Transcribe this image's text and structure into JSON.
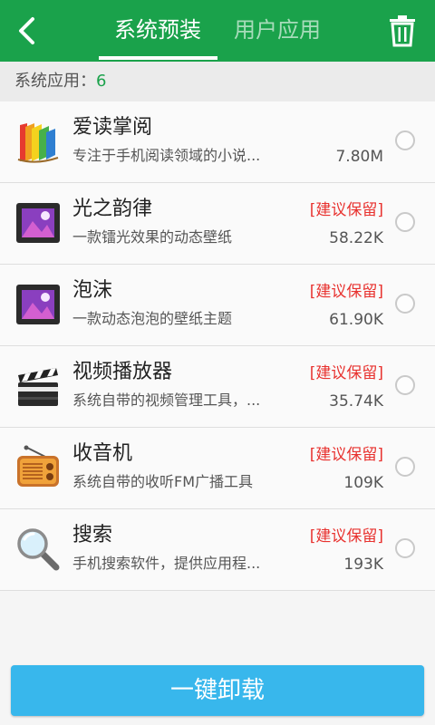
{
  "header": {
    "back_icon": "chevron-left-icon",
    "tabs": [
      {
        "label": "系统预装",
        "active": true
      },
      {
        "label": "用户应用",
        "active": false
      }
    ],
    "trash_icon": "trash-icon",
    "accent_color": "#1aa24b"
  },
  "summary": {
    "label": "系统应用：",
    "count": "6"
  },
  "apps": [
    {
      "name": "爱读掌阅",
      "description": "专注于手机阅读领域的小说...",
      "size": "7.80M",
      "tag": "",
      "icon": "book-icon"
    },
    {
      "name": "光之韵律",
      "description": "一款镭光效果的动态壁纸",
      "size": "58.22K",
      "tag": "[建议保留]",
      "icon": "picture-icon"
    },
    {
      "name": "泡沫",
      "description": "一款动态泡泡的壁纸主题",
      "size": "61.90K",
      "tag": "[建议保留]",
      "icon": "picture-icon"
    },
    {
      "name": "视频播放器",
      "description": "系统自带的视频管理工具，...",
      "size": "35.74K",
      "tag": "[建议保留]",
      "icon": "clapperboard-icon"
    },
    {
      "name": "收音机",
      "description": "系统自带的收听FM广播工具",
      "size": "109K",
      "tag": "[建议保留]",
      "icon": "radio-icon"
    },
    {
      "name": "搜索",
      "description": "手机搜索软件，提供应用程...",
      "size": "193K",
      "tag": "[建议保留]",
      "icon": "magnifier-icon"
    }
  ],
  "actions": {
    "uninstall_all": "一键卸载",
    "button_color": "#38b7ec"
  }
}
